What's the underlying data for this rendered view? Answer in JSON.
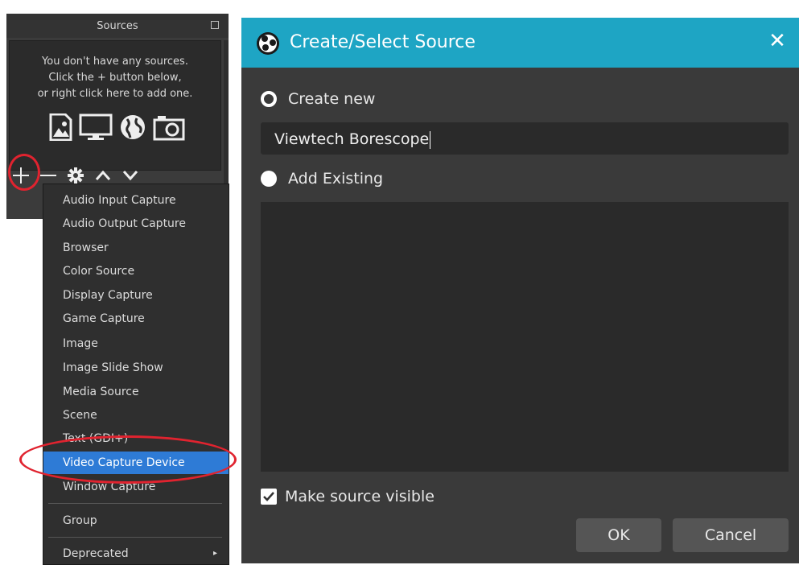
{
  "sources_dock": {
    "title": "Sources",
    "empty_message": [
      "You don't have any sources.",
      "Click the + button below,",
      "or right click here to add one."
    ],
    "source_type_icons": [
      "image-icon",
      "display-icon",
      "browser-globe-icon",
      "camera-icon"
    ],
    "toolbar": [
      "plus-icon",
      "minus-icon",
      "gear-icon",
      "chevron-up-icon",
      "chevron-down-icon"
    ]
  },
  "context_menu": {
    "items": [
      "Audio Input Capture",
      "Audio Output Capture",
      "Browser",
      "Color Source",
      "Display Capture",
      "Game Capture",
      "Image",
      "Image Slide Show",
      "Media Source",
      "Scene",
      "Text (GDI+)",
      "Video Capture Device",
      "Window Capture"
    ],
    "selected": "Video Capture Device",
    "group": "Group",
    "deprecated": "Deprecated"
  },
  "dialog": {
    "title": "Create/Select Source",
    "create_new_label": "Create new",
    "name_value": "Viewtech Borescope",
    "add_existing_label": "Add Existing",
    "make_visible_label": "Make source visible",
    "make_visible_checked": true,
    "ok_label": "OK",
    "cancel_label": "Cancel"
  },
  "colors": {
    "titlebar": "#1ea5c4",
    "selection": "#2e7bd6",
    "annotation_circle": "#e0232f"
  }
}
